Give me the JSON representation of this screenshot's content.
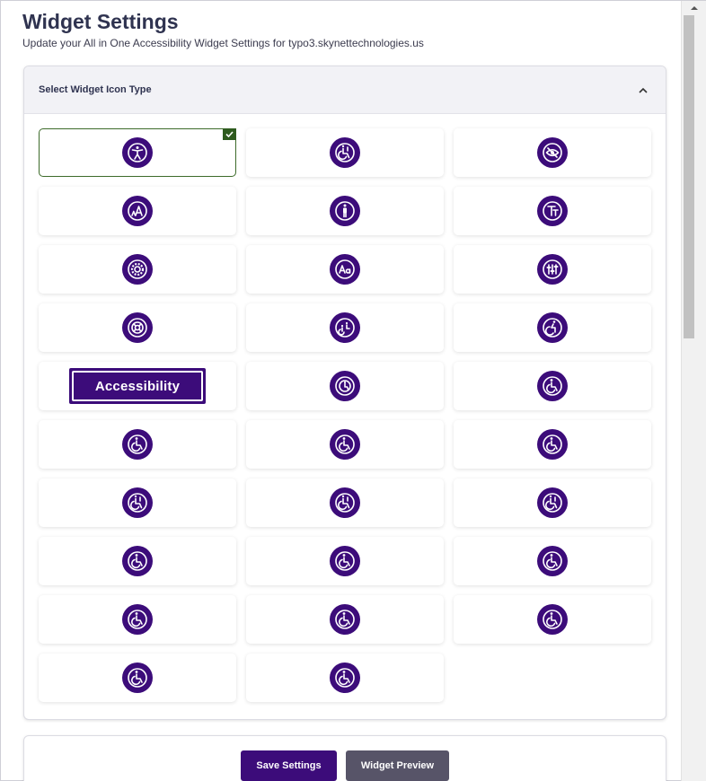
{
  "header": {
    "title": "Widget Settings",
    "subtitle": "Update your All in One Accessibility Widget Settings for typo3.skynettechnologies.us"
  },
  "panel": {
    "title": "Select Widget Icon Type",
    "collapse_icon": "chevron-up-icon"
  },
  "icons": [
    {
      "id": 1,
      "icon": "accessibility-person-icon",
      "selected": true
    },
    {
      "id": 2,
      "icon": "wheelchair-info-icon"
    },
    {
      "id": 3,
      "icon": "eye-slash-icon"
    },
    {
      "id": 4,
      "icon": "text-size-icon"
    },
    {
      "id": 5,
      "icon": "person-standing-icon"
    },
    {
      "id": 6,
      "icon": "text-resize-icon"
    },
    {
      "id": 7,
      "icon": "gear-icon"
    },
    {
      "id": 8,
      "icon": "font-aa-icon"
    },
    {
      "id": 9,
      "icon": "sliders-icon"
    },
    {
      "id": 10,
      "icon": "lifebuoy-icon"
    },
    {
      "id": 11,
      "icon": "wheelchair-group-icon"
    },
    {
      "id": 12,
      "icon": "wheelchair-active-icon"
    },
    {
      "id": 13,
      "icon": "accessibility-text-badge",
      "text": "Accessibility"
    },
    {
      "id": 14,
      "icon": "wheelchair-ring-icon"
    },
    {
      "id": 15,
      "icon": "wheelchair-icon"
    },
    {
      "id": 16,
      "icon": "wheelchair-icon"
    },
    {
      "id": 17,
      "icon": "wheelchair-icon"
    },
    {
      "id": 18,
      "icon": "wheelchair-icon"
    },
    {
      "id": 19,
      "icon": "wheelchair-info-icon"
    },
    {
      "id": 20,
      "icon": "wheelchair-info-icon"
    },
    {
      "id": 21,
      "icon": "wheelchair-info-icon"
    },
    {
      "id": 22,
      "icon": "wheelchair-icon"
    },
    {
      "id": 23,
      "icon": "wheelchair-icon"
    },
    {
      "id": 24,
      "icon": "wheelchair-icon"
    },
    {
      "id": 25,
      "icon": "wheelchair-icon"
    },
    {
      "id": 26,
      "icon": "wheelchair-icon"
    },
    {
      "id": 27,
      "icon": "wheelchair-icon"
    },
    {
      "id": 28,
      "icon": "wheelchair-icon"
    },
    {
      "id": 29,
      "icon": "wheelchair-icon"
    }
  ],
  "footer": {
    "save_label": "Save Settings",
    "preview_label": "Widget Preview"
  },
  "colors": {
    "brand_purple": "#3c0c7a",
    "selected_green": "#2e5b1e",
    "preview_gray": "#575468"
  }
}
